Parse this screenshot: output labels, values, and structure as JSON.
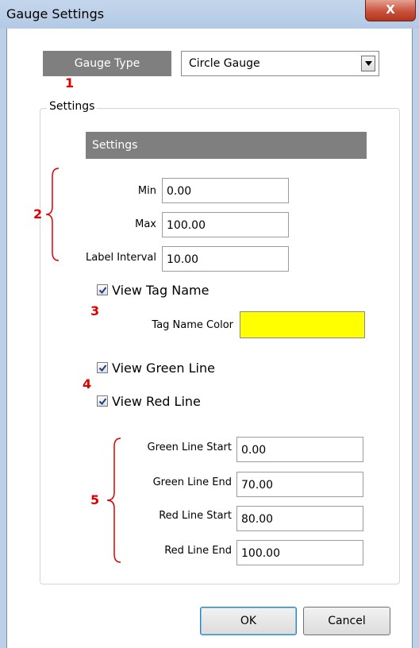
{
  "window": {
    "title": "Gauge Settings",
    "close_glyph": "X"
  },
  "gauge_type": {
    "label": "Gauge Type",
    "selected": "Circle Gauge"
  },
  "settings_group": {
    "title": "Settings",
    "header": "Settings"
  },
  "range_fields": [
    {
      "label": "Min",
      "value": "0.00"
    },
    {
      "label": "Max",
      "value": "100.00"
    },
    {
      "label": "Label Interval",
      "value": "10.00"
    }
  ],
  "view_tag_name": {
    "label": "View Tag Name",
    "checked": true
  },
  "tag_name_color": {
    "label": "Tag Name Color",
    "color": "#ffff00"
  },
  "view_green_line": {
    "label": "View Green Line",
    "checked": true
  },
  "view_red_line": {
    "label": "View Red Line",
    "checked": true
  },
  "line_fields": [
    {
      "label": "Green Line Start",
      "value": "0.00"
    },
    {
      "label": "Green Line End",
      "value": "70.00"
    },
    {
      "label": "Red Line Start",
      "value": "80.00"
    },
    {
      "label": "Red Line End",
      "value": "100.00"
    }
  ],
  "annotations": [
    "1",
    "2",
    "3",
    "4",
    "5"
  ],
  "buttons": {
    "ok": "OK",
    "cancel": "Cancel"
  },
  "colors": {
    "annotation": "#e00000",
    "header_gray": "#7f7f7f"
  }
}
